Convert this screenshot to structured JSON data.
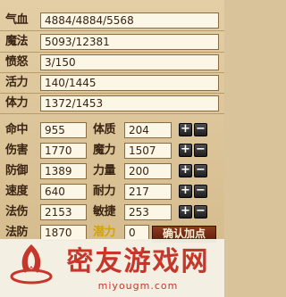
{
  "resources": [
    {
      "label": "气血",
      "value": "4884/4884/5568"
    },
    {
      "label": "魔法",
      "value": "5093/12381"
    },
    {
      "label": "愤怒",
      "value": "3/150"
    },
    {
      "label": "活力",
      "value": "140/1445"
    },
    {
      "label": "体力",
      "value": "1372/1453"
    }
  ],
  "stats_left": [
    {
      "label": "命中",
      "value": "955"
    },
    {
      "label": "伤害",
      "value": "1770"
    },
    {
      "label": "防御",
      "value": "1389"
    },
    {
      "label": "速度",
      "value": "640"
    },
    {
      "label": "法伤",
      "value": "2153"
    },
    {
      "label": "法防",
      "value": "1870"
    }
  ],
  "stats_right": [
    {
      "label": "体质",
      "value": "204"
    },
    {
      "label": "魔力",
      "value": "1507"
    },
    {
      "label": "力量",
      "value": "200"
    },
    {
      "label": "耐力",
      "value": "217"
    },
    {
      "label": "敏捷",
      "value": "253"
    }
  ],
  "potential": {
    "label": "潜力",
    "value": "0"
  },
  "buttons": {
    "plus": "+",
    "minus": "−",
    "confirm": "确认加点"
  },
  "watermark": {
    "title": "密友游戏网",
    "url": "miyougm.com"
  },
  "colors": {
    "panel": "#d9c39a",
    "field": "#fbf6e6",
    "potential_label": "#d4a20a",
    "watermark": "#c7362a"
  }
}
